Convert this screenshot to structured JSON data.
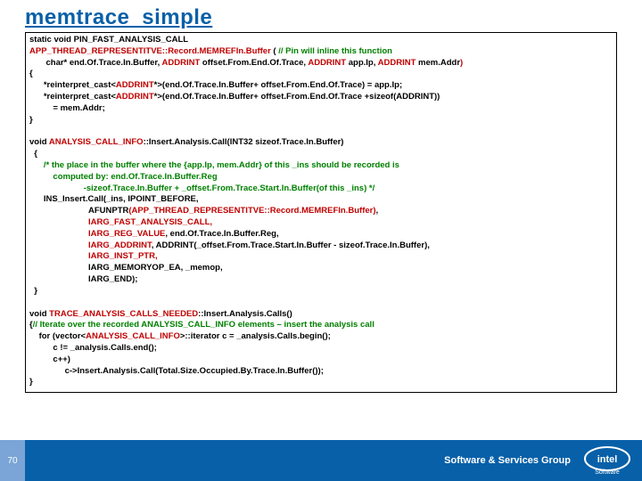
{
  "title": "memtrace_simple",
  "code": {
    "l1": "static void PIN_FAST_ANALYSIS_CALL",
    "l2a": "APP_THREAD_REPRESENTITVE::Record.MEMREFIn.Buffer",
    "l2b": " ( ",
    "l2c": "// Pin will inline this function",
    "l3a": "       char* end.Of.Trace.In.Buffer, ",
    "l3b": "ADDRINT",
    "l3c": " offset.From.End.Of.Trace, ",
    "l3d": "ADDRINT",
    "l3e": " app.Ip, ",
    "l3f": "ADDRINT",
    "l3g": " mem.Addr",
    "l3h": ")",
    "l4": "{",
    "l5a": "      *reinterpret_cast<",
    "l5b": "ADDRINT",
    "l5c": "*>(end.Of.Trace.In.Buffer+ offset.From.End.Of.Trace) = app.Ip;",
    "l6a": "      *reinterpret_cast<",
    "l6b": "ADDRINT",
    "l6c": "*>(end.Of.Trace.In.Buffer+ offset.From.End.Of.Trace +sizeof(ADDRINT))",
    "l7": "          = mem.Addr;",
    "l8": "}",
    "blank1": " ",
    "l9a": "void ",
    "l9b": "ANALYSIS_CALL_INFO",
    "l9c": "::Insert.Analysis.Call(INT32 sizeof.Trace.In.Buffer)",
    "l10": "  {",
    "l11": "      /* the place in the buffer where the {app.Ip, mem.Addr} of this _ins should be recorded is",
    "l12": "          computed by: end.Of.Trace.In.Buffer.Reg",
    "l13": "                       -sizeof.Trace.In.Buffer + _offset.From.Trace.Start.In.Buffer(of this _ins) */",
    "l14": "      INS_Insert.Call(_ins, IPOINT_BEFORE,",
    "l15a": "                         AFUNPTR",
    "l15b": "(APP_THREAD_REPRESENTITVE::Record.MEMREFIn.Buffer)",
    "l15c": ",",
    "l16": "                         IARG_FAST_ANALYSIS_CALL,",
    "l17a": "                         IARG_REG_VALUE",
    "l17b": ", end.Of.Trace.In.Buffer.Reg,",
    "l18a": "                         IARG_ADDRINT",
    "l18b": ", ADDRINT(_offset.From.Trace.Start.In.Buffer - sizeof.Trace.In.Buffer),",
    "l19": "                         IARG_INST_PTR,",
    "l20": "                         IARG_MEMORYOP_EA, _memop,",
    "l21": "                         IARG_END);",
    "l22": "  }",
    "blank2": " ",
    "l23a": "void ",
    "l23b": "TRACE_ANALYSIS_CALLS_NEEDED",
    "l23c": "::Insert.Analysis.Calls()",
    "l24a": "{",
    "l24b": "// Iterate over the recorded ANALYSIS_CALL_INFO elements – insert the analysis call",
    "l25a": "    for (vector<",
    "l25b": "ANALYSIS_CALL_INFO",
    "l25c": ">::iterator c = _analysis.Calls.begin();",
    "l26": "          c != _analysis.Calls.end();",
    "l27": "          c++)",
    "l28": "               c->Insert.Analysis.Call(Total.Size.Occupied.By.Trace.In.Buffer());",
    "l29": "}"
  },
  "footer": {
    "group": "Software & Services Group",
    "page": "70",
    "brand": "intel",
    "sub": "Software"
  }
}
